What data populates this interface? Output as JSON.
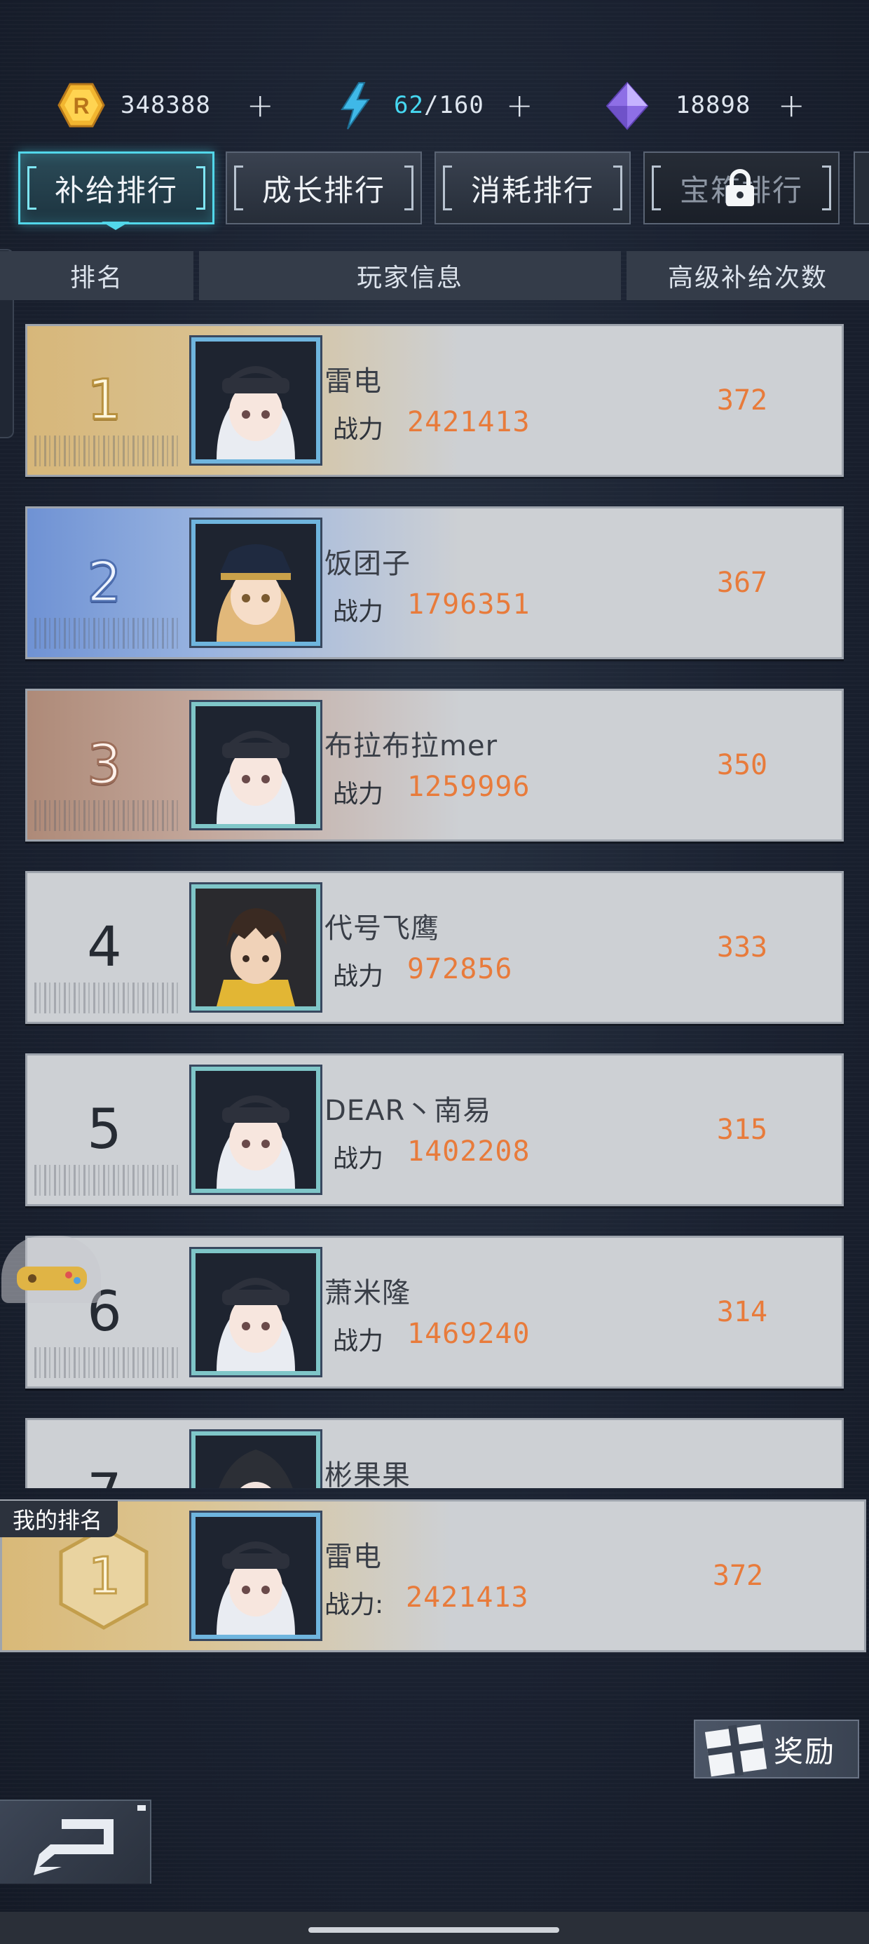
{
  "resources": {
    "coin": {
      "value": "348388",
      "plus": "+",
      "icon": "coin-icon"
    },
    "energy": {
      "current": "62",
      "sep_max": "/160",
      "plus": "+",
      "icon": "lightning-icon"
    },
    "gem": {
      "value": "18898",
      "plus": "+",
      "icon": "crystal-icon"
    }
  },
  "tabs": [
    {
      "label": "补给排行",
      "active": true
    },
    {
      "label": "成长排行",
      "active": false
    },
    {
      "label": "消耗排行",
      "active": false
    },
    {
      "label": "宝箱排行",
      "active": false,
      "locked": true
    }
  ],
  "table": {
    "headers": [
      "排名",
      "玩家信息",
      "高级补给次数"
    ],
    "power_label": "战力",
    "rows": [
      {
        "rank": "1",
        "name": "雷电",
        "power": "2421413",
        "count": "372"
      },
      {
        "rank": "2",
        "name": "饭团子",
        "power": "1796351",
        "count": "367"
      },
      {
        "rank": "3",
        "name": "布拉布拉mer",
        "power": "1259996",
        "count": "350"
      },
      {
        "rank": "4",
        "name": "代号飞鹰",
        "power": "972856",
        "count": "333"
      },
      {
        "rank": "5",
        "name": "DEAR丶南易",
        "power": "1402208",
        "count": "315"
      },
      {
        "rank": "6",
        "name": "萧米隆",
        "power": "1469240",
        "count": "314"
      },
      {
        "rank": "7",
        "name": "彬果果",
        "power": "",
        "count": ""
      }
    ]
  },
  "my_rank": {
    "tag": "我的排名",
    "rank": "1",
    "name": "雷电",
    "power_label": "战力:",
    "power": "2421413",
    "count": "372"
  },
  "bottom": {
    "reward_label": "奖励",
    "reward_icon": "gift-icon",
    "back_icon": "back-arrow-icon"
  },
  "colors": {
    "accent": "#52d7ea",
    "value_orange": "#e87b3b",
    "gold_row": "#d7b77a",
    "silver_row": "#6f92d4",
    "bronze_row": "#ae8a78"
  }
}
